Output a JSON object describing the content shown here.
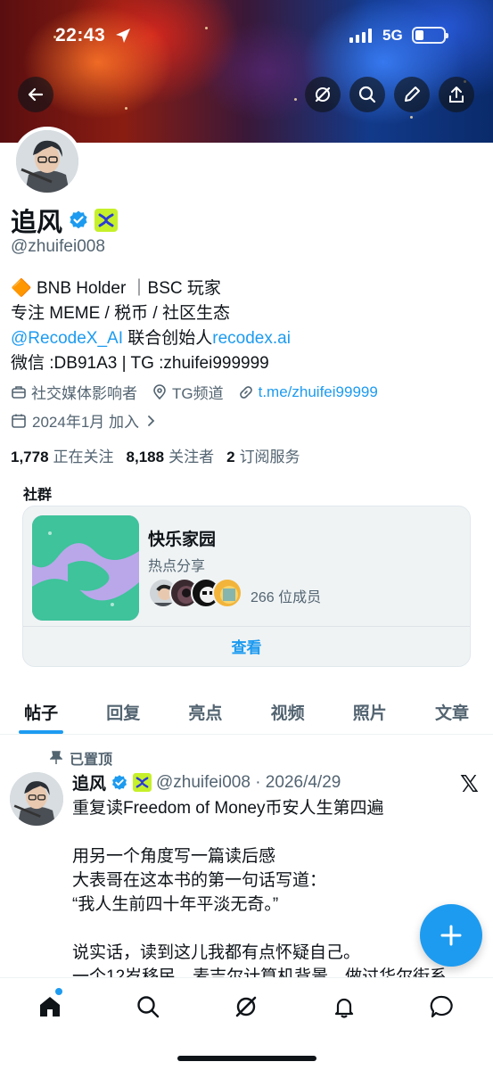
{
  "status_bar": {
    "time": "22:43",
    "network": "5G"
  },
  "profile": {
    "name": "追风",
    "handle": "@zhuifei008",
    "bio": {
      "line1_emoji": "🔶",
      "line1_text": " BNB Holder ｜BSC 玩家",
      "line2": "专注 MEME / 税币 / 社区生态",
      "line3_mention": "@RecodeX_AI",
      "line3_text": " 联合创始人",
      "line3_link": "recodex.ai",
      "line4": "微信 :DB91A3 | TG :zhuifei999999"
    },
    "category": "社交媒体影响者",
    "location": "TG频道",
    "website": "t.me/zhuifei99999",
    "joined": "2024年1月 加入",
    "following_count": "1,778",
    "following_label": "正在关注",
    "followers_count": "8,188",
    "followers_label": "关注者",
    "subscriptions_count": "2",
    "subscriptions_label": "订阅服务"
  },
  "community_section": {
    "label": "社群",
    "name": "快乐家园",
    "description": "热点分享",
    "member_count": "266 位成员",
    "view_label": "查看"
  },
  "tabs": [
    "帖子",
    "回复",
    "亮点",
    "视频",
    "照片",
    "文章"
  ],
  "post": {
    "pinned_label": "已置顶",
    "author": "追风",
    "handle_date": "@zhuifei008 · 2026/4/29",
    "text": "重复读Freedom of Money币安人生第四遍\n\n用另一个角度写一篇读后感\n大表哥在这本书的第一句话写道：\n“我人生前四十年平淡无奇。”\n\n说实话，读到这儿我都有点怀疑自己。\n一个12岁移民，麦吉尔计算机背景，做过华尔街系"
  },
  "colors": {
    "accent": "#1d9bf0",
    "text_primary": "#0f1419",
    "text_secondary": "#536471",
    "affiliate_badge": "#c6f02a"
  }
}
